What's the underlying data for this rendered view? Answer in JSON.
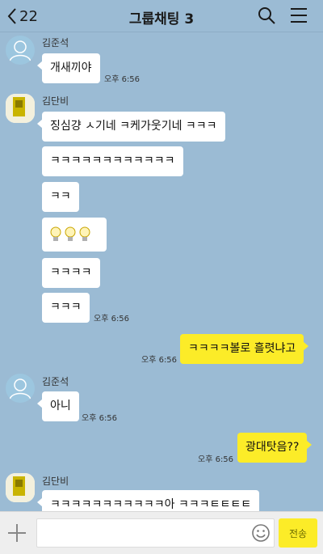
{
  "header": {
    "back_count": "22",
    "title": "그룹채팅 3"
  },
  "messages": [
    {
      "sender": "김준석",
      "text": "개새끼야",
      "time": "오후 6:56"
    },
    {
      "sender": "김단비",
      "texts": [
        "징심걍 ㅅ기네 ㅋ케가웃기네 ㅋㅋㅋ",
        "ㅋㅋㅋㅋㅋㅋㅋㅋㅋㅋㅋㅋ",
        "ㅋㅋ",
        "ㅋㅋㅋㅋ",
        "ㅋㅋㅋ"
      ],
      "time": "오후 6:56"
    },
    {
      "mine": true,
      "text": "ㅋㅋㅋㅋ볼로 흘렷냐고",
      "time": "오후 6:56"
    },
    {
      "sender": "김준석",
      "text": "아니",
      "time": "오후 6:56"
    },
    {
      "mine": true,
      "text": "광대탓음??",
      "time": "오후 6:56"
    },
    {
      "sender": "김단비",
      "text": "ㅋㅋㅋㅋㅋㅋㅋㅋㅋㅋㅋ아 ㅋㅋㅋㅌㅌㅌㅌ"
    }
  ],
  "input": {
    "send_label": "전송"
  },
  "icons": {
    "back": "chevron-left-icon",
    "search": "search-icon",
    "menu": "menu-icon",
    "plus": "plus-icon",
    "emoji": "emoji-icon",
    "bulb": "lightbulb-icon"
  },
  "colors": {
    "background": "#9bbbd4",
    "my_bubble": "#fcec28",
    "other_bubble": "#ffffff"
  }
}
